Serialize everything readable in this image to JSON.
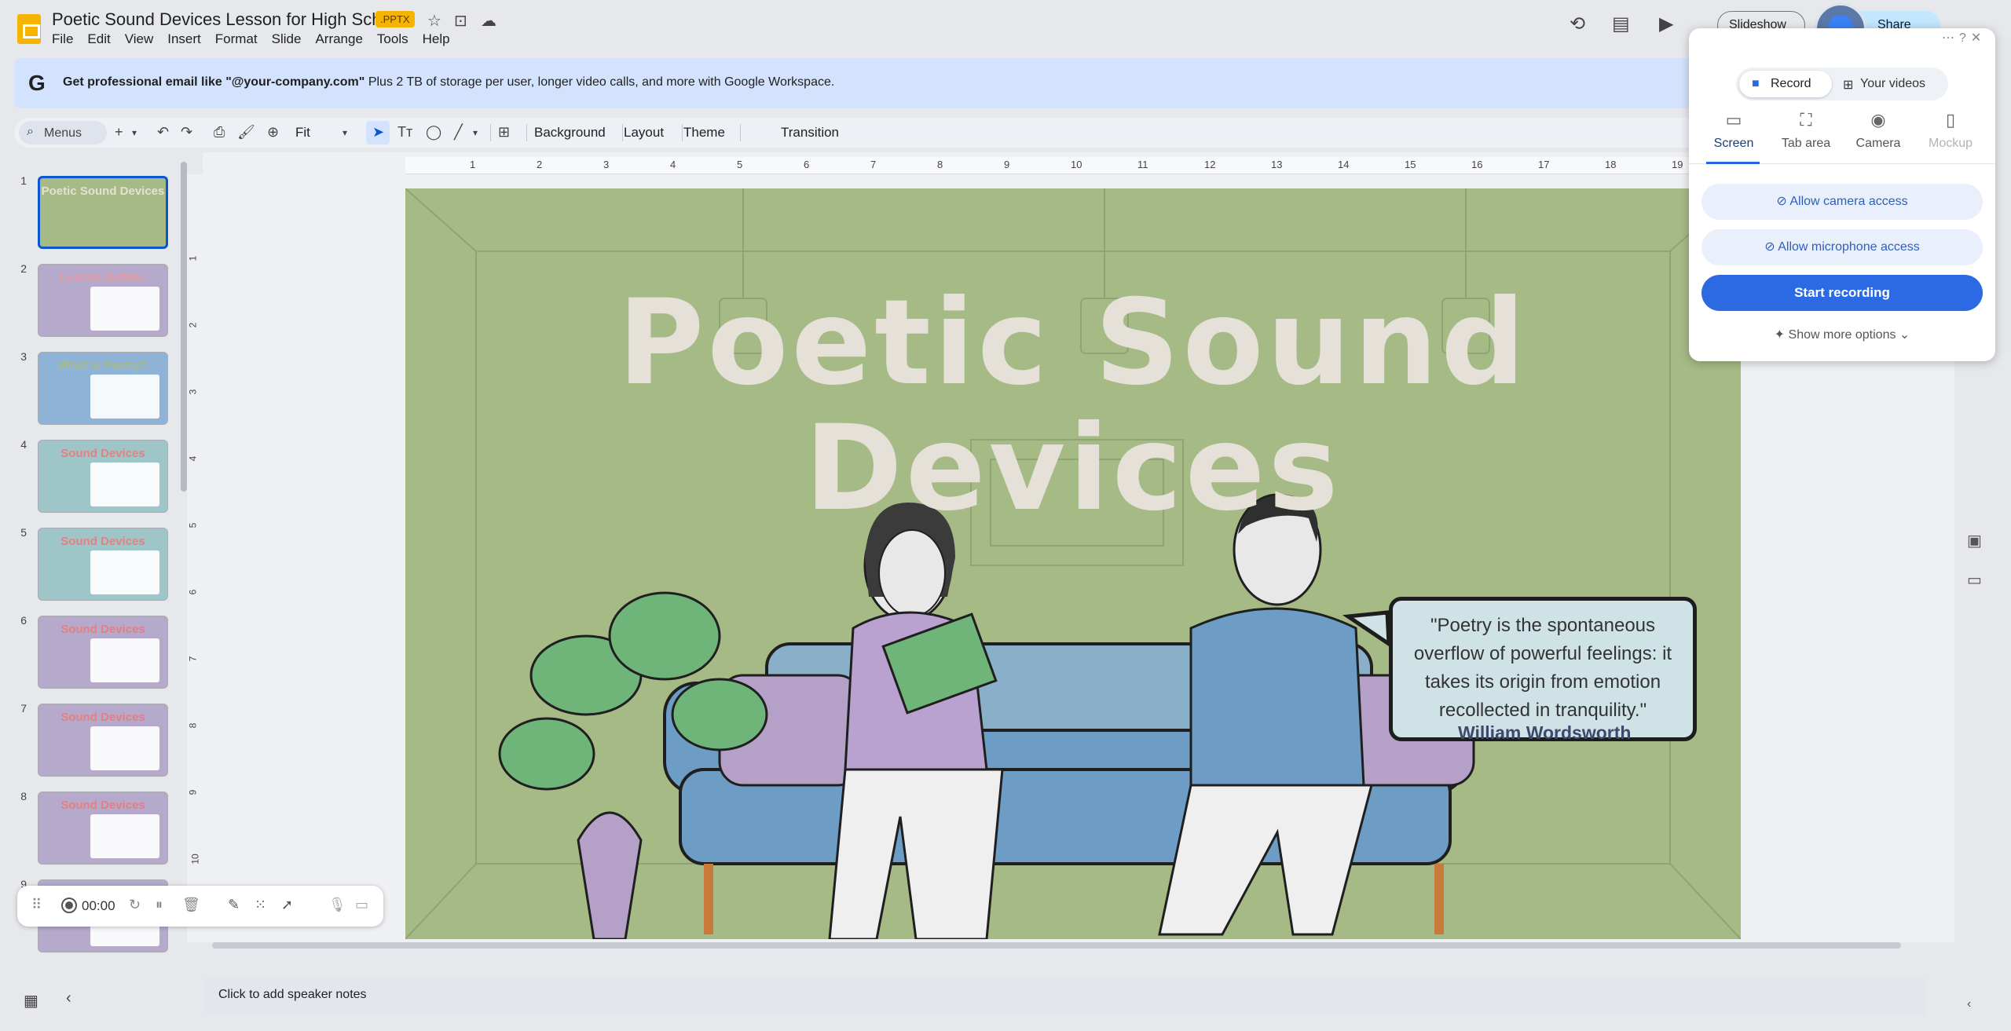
{
  "header": {
    "doc_title": "Poetic Sound Devices Lesson for High School",
    "file_badge": ".PPTX",
    "menus": [
      "File",
      "Edit",
      "View",
      "Insert",
      "Format",
      "Slide",
      "Arrange",
      "Tools",
      "Help"
    ],
    "slideshow_label": "Slideshow",
    "share_label": "Share"
  },
  "banner": {
    "logo": "G",
    "bold_text": "Get professional email like \"@your-company.com\"",
    "text": "Plus 2 TB of storage per user, longer video calls, and more with Google Workspace."
  },
  "toolbar": {
    "menus_label": "Menus",
    "zoom_label": "Fit",
    "background_label": "Background",
    "layout_label": "Layout",
    "theme_label": "Theme",
    "transition_label": "Transition"
  },
  "filmstrip": {
    "slides": [
      {
        "num": "1",
        "title": "Poetic Sound Devices",
        "bg": "#a6ba86",
        "title_color": "#e5e0d8"
      },
      {
        "num": "2",
        "title": "Lesson Outline",
        "bg": "#b5a9cc",
        "title_color": "#e89aa0"
      },
      {
        "num": "3",
        "title": "What is Poetry?",
        "bg": "#8eb3d6",
        "title_color": "#a6ba86"
      },
      {
        "num": "4",
        "title": "Sound Devices",
        "bg": "#9ec6c8",
        "title_color": "#e67f7f"
      },
      {
        "num": "5",
        "title": "Sound Devices",
        "bg": "#9ec6c8",
        "title_color": "#e67f7f"
      },
      {
        "num": "6",
        "title": "Sound Devices",
        "bg": "#b5a9cc",
        "title_color": "#e67f7f"
      },
      {
        "num": "7",
        "title": "Sound Devices",
        "bg": "#b5a9cc",
        "title_color": "#e67f7f"
      },
      {
        "num": "8",
        "title": "Sound Devices",
        "bg": "#b5a9cc",
        "title_color": "#e67f7f"
      },
      {
        "num": "9",
        "title": "",
        "bg": "#b5a9cc",
        "title_color": "#e67f7f"
      }
    ]
  },
  "ruler": {
    "h_ticks": [
      "1",
      "2",
      "3",
      "4",
      "5",
      "6",
      "7",
      "8",
      "9",
      "10",
      "11",
      "12",
      "13",
      "14",
      "15",
      "16",
      "17",
      "18",
      "19"
    ],
    "v_ticks": [
      "1",
      "2",
      "3",
      "4",
      "5",
      "6",
      "7",
      "8",
      "9",
      "10"
    ]
  },
  "slide": {
    "title_line1": "Poetic Sound",
    "title_line2": "Devices",
    "quote": "\"Poetry is the spontaneous overflow of powerful feelings: it takes its origin from emotion recollected in tranquility.\"",
    "quote_author": "William Wordsworth"
  },
  "notes": {
    "placeholder": "Click to add speaker notes"
  },
  "recording_bar": {
    "time": "00:00"
  },
  "recorder_popup": {
    "tab_record": "Record",
    "tab_videos": "Your videos",
    "modes": [
      "Screen",
      "Tab area",
      "Camera",
      "Mockup"
    ],
    "camera_btn": "Allow camera access",
    "mic_btn": "Allow microphone access",
    "start_btn": "Start recording",
    "more_options": "Show more options"
  },
  "colors": {
    "accent": "#0b57d0",
    "banner_bg": "#d3e3fd",
    "slide_bg": "#a6ba86",
    "record_blue": "#2c6ae3"
  }
}
